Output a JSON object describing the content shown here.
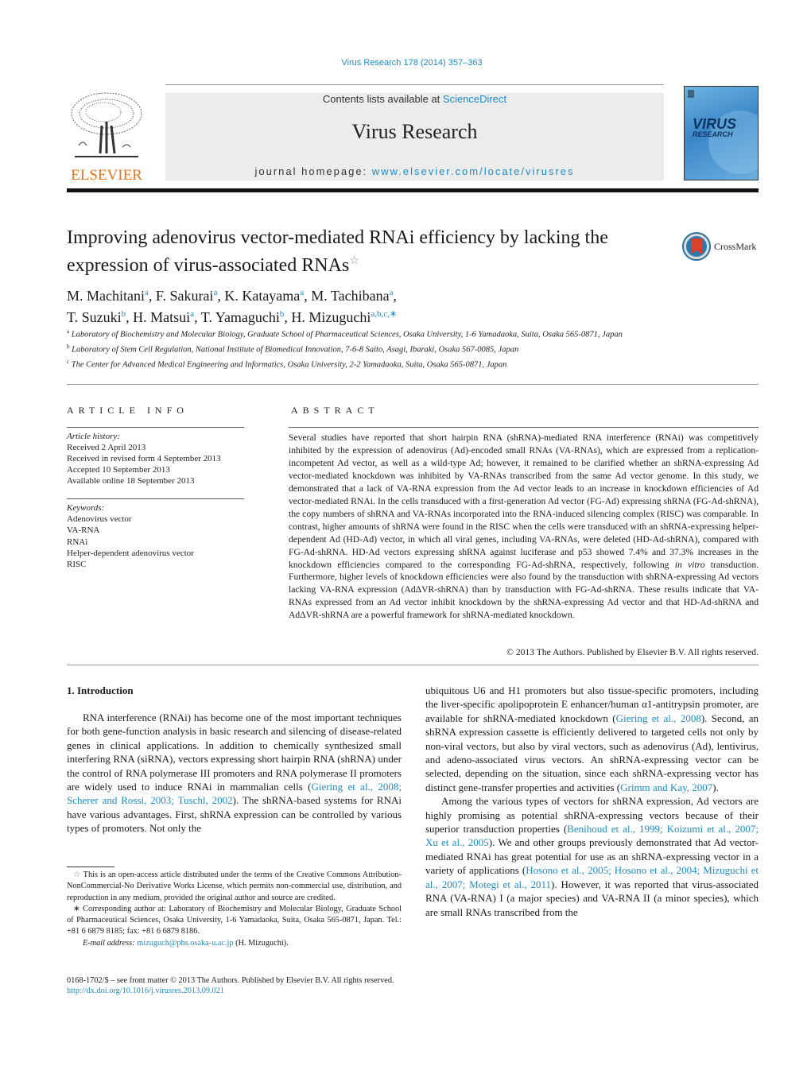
{
  "header": {
    "journal_ref": "Virus Research 178 (2014) 357–363",
    "contents_prefix": "Contents lists available at ",
    "contents_link": "ScienceDirect",
    "journal_name": "Virus Research",
    "homepage_prefix": "journal homepage: ",
    "homepage_link": "www.elsevier.com/locate/virusres",
    "publisher_logo": "ELSEVIER",
    "cover_title_1": "VIRUS",
    "cover_title_2": "RESEARCH"
  },
  "article": {
    "title": "Improving adenovirus vector-mediated RNAi efficiency by lacking the expression of virus-associated RNAs",
    "title_mark": "☆",
    "crossmark_label": "CrossMark",
    "authors": [
      {
        "name": "M. Machitani",
        "aff": "a",
        "sep": ", "
      },
      {
        "name": "F. Sakurai",
        "aff": "a",
        "sep": ", "
      },
      {
        "name": "K. Katayama",
        "aff": "a",
        "sep": ", "
      },
      {
        "name": "M. Tachibana",
        "aff": "a",
        "sep": ","
      },
      {
        "name": "T. Suzuki",
        "aff": "b",
        "sep": ", "
      },
      {
        "name": "H. Matsui",
        "aff": "a",
        "sep": ", "
      },
      {
        "name": "T. Yamaguchi",
        "aff": "b",
        "sep": ", "
      },
      {
        "name": "H. Mizuguchi",
        "aff": "a,b,c,∗",
        "sep": ""
      }
    ],
    "affiliations": [
      {
        "mark": "a",
        "text": "Laboratory of Biochemistry and Molecular Biology, Graduate School of Pharmaceutical Sciences, Osaka University, 1-6 Yamadaoka, Suita, Osaka 565-0871, Japan"
      },
      {
        "mark": "b",
        "text": "Laboratory of Stem Cell Regulation, National Institute of Biomedical Innovation, 7-6-8 Saito, Asagi, Ibaraki, Osaka 567-0085, Japan"
      },
      {
        "mark": "c",
        "text": "The Center for Advanced Medical Engineering and Informatics, Osaka University, 2-2 Yamadaoka, Suita, Osaka 565-0871, Japan"
      }
    ]
  },
  "article_info": {
    "heading": "ARTICLE INFO",
    "history_label": "Article history:",
    "history": [
      "Received 2 April 2013",
      "Received in revised form 4 September 2013",
      "Accepted 10 September 2013",
      "Available online 18 September 2013"
    ],
    "keywords_label": "Keywords:",
    "keywords": [
      "Adenovirus vector",
      "VA-RNA",
      "RNAi",
      "Helper-dependent adenovirus vector",
      "RISC"
    ]
  },
  "abstract": {
    "heading": "ABSTRACT",
    "text_1": "Several studies have reported that short hairpin RNA (shRNA)-mediated RNA interference (RNAi) was competitively inhibited by the expression of adenovirus (Ad)-encoded small RNAs (VA-RNAs), which are expressed from a replication-incompetent Ad vector, as well as a wild-type Ad; however, it remained to be clarified whether an shRNA-expressing Ad vector-mediated knockdown was inhibited by VA-RNAs transcribed from the same Ad vector genome. In this study, we demonstrated that a lack of VA-RNA expression from the Ad vector leads to an increase in knockdown efficiencies of Ad vector-mediated RNAi. In the cells transduced with a first-generation Ad vector (FG-Ad) expressing shRNA (FG-Ad-shRNA), the copy numbers of shRNA and VA-RNAs incorporated into the RNA-induced silencing complex (RISC) was comparable. In contrast, higher amounts of shRNA were found in the RISC when the cells were transduced with an shRNA-expressing helper-dependent Ad (HD-Ad) vector, in which all viral genes, including VA-RNAs, were deleted (HD-Ad-shRNA), compared with FG-Ad-shRNA. HD-Ad vectors expressing shRNA against luciferase and p53 showed 7.4% and 37.3% increases in the knockdown efficiencies compared to the corresponding FG-Ad-shRNA, respectively, following ",
    "text_italic": "in vitro",
    "text_2": " transduction. Furthermore, higher levels of knockdown efficiencies were also found by the transduction with shRNA-expressing Ad vectors lacking VA-RNA expression (AdΔVR-shRNA) than by transduction with FG-Ad-shRNA. These results indicate that VA-RNAs expressed from an Ad vector inhibit knockdown by the shRNA-expressing Ad vector and that HD-Ad-shRNA and AdΔVR-shRNA are a powerful framework for shRNA-mediated knockdown.",
    "copyright": "© 2013 The Authors. Published by Elsevier B.V. All rights reserved."
  },
  "introduction": {
    "heading": "1.  Introduction",
    "p1_a": "RNA interference (RNAi) has become one of the most impor­tant techniques for both gene-function analysis in basic research and silencing of disease-related genes in clinical applications. In addition to chemically synthesized small interfering RNA (siRNA), vectors expressing short hairpin RNA (shRNA) under the control of RNA polymerase III promoters and RNA polymerase II promoters are widely used to induce RNAi in mammalian cells (",
    "p1_cite": "Giering et al., 2008; Scherer and Rossi, 2003; Tuschl, 2002",
    "p1_b": "). The shRNA-based systems for RNAi have various advantages. First, shRNA expres­sion can be controlled by various types of promoters. Not only the",
    "p1_c": "ubiquitous U6 and H1 promoters but also tissue-specific promot­ers, including the liver-specific apolipoprotein E enhancer/human α1-antitrypsin promoter, are available for shRNA-mediated knock­down (",
    "p1_cite2": "Giering et al., 2008",
    "p1_d": "). Second, an shRNA expression cassette is efficiently delivered to targeted cells not only by non-viral vectors, but also by viral vectors, such as adenovirus (Ad), lentivirus, and adeno-associated virus vectors. An shRNA-expressing vector can be selected, depending on the situation, since each shRNA-expressing vector has distinct gene-transfer properties and activities (",
    "p1_cite3": "Grimm and Kay, 2007",
    "p1_e": ").",
    "p2_a": "Among the various types of vectors for shRNA expression, Ad vectors are highly promising as potential shRNA-expressing vec­tors because of their superior transduction properties (",
    "p2_cite1": "Benihoud et al., 1999; Koizumi et al., 2007; Xu et al., 2005",
    "p2_b": "). We and other groups previously demonstrated that Ad vector-mediated RNAi has great potential for use as an shRNA-expressing vector in a variety of applications (",
    "p2_cite2": "Hosono et al., 2005; Hosono et al., 2004; Mizuguchi et al., 2007; Motegi et al., 2011",
    "p2_c": "). However, it was reported that virus-associated RNA (VA-RNA) I (a major species) and VA-RNA II (a minor species), which are small RNAs transcribed from the"
  },
  "footnotes": {
    "star_mark": "☆",
    "open_access": "This is an open-access article distributed under the terms of the Creative Com­mons Attribution-NonCommercial-No Derivative Works License, which permits non-commercial use, distribution, and reproduction in any medium, provided the original author and source are credited.",
    "corr_mark": "∗",
    "corresponding": "Corresponding author at: Laboratory of Biochemistry and Molecular Biology, Graduate School of Pharmaceutical Sciences, Osaka University, 1-6 Yamadaoka, Suita, Osaka 565-0871, Japan. Tel.: +81 6 6879 8185; fax: +81 6 6879 8186.",
    "email_label": "E-mail address:",
    "email": "mizuguch@phs.osaka-u.ac.jp",
    "email_owner": " (H. Mizuguchi).",
    "issn": "0168-1702/$ – see front matter © 2013 The Authors. Published by Elsevier B.V. All rights reserved.",
    "doi": "http://dx.doi.org/10.1016/j.virusres.2013.09.021"
  },
  "colors": {
    "link": "#1e8bc3",
    "elsevier_orange": "#e8731a",
    "header_band": "#ececec"
  }
}
